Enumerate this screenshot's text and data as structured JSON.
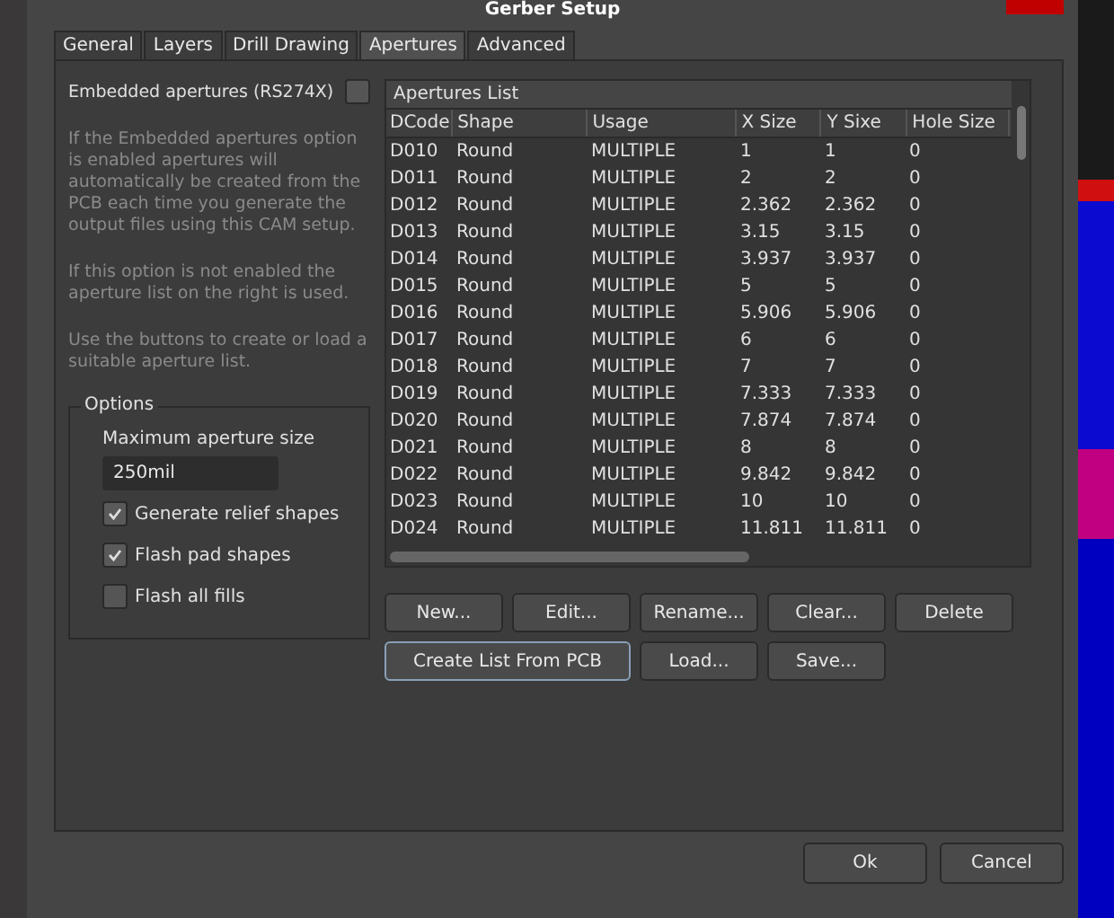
{
  "window": {
    "title": "Gerber Setup"
  },
  "tabs": [
    {
      "label": "General",
      "selected": false
    },
    {
      "label": "Layers",
      "selected": false
    },
    {
      "label": "Drill Drawing",
      "selected": false
    },
    {
      "label": "Apertures",
      "selected": true
    },
    {
      "label": "Advanced",
      "selected": false
    }
  ],
  "embedded": {
    "label": "Embedded apertures (RS274X)",
    "checked": false
  },
  "help_texts": [
    "If the Embedded apertures option is enabled apertures will automatically be created from the PCB each time you generate the output files using this CAM setup.",
    "If this option is not enabled the aperture list on the right is used.",
    "Use the buttons to create or load a suitable aperture list."
  ],
  "options": {
    "title": "Options",
    "max_size_label": "Maximum aperture size",
    "max_size_value": "250mil",
    "checkboxes": [
      {
        "label": "Generate relief shapes",
        "checked": true
      },
      {
        "label": "Flash pad shapes",
        "checked": true
      },
      {
        "label": "Flash all fills",
        "checked": false
      }
    ]
  },
  "apertures_list": {
    "title": "Apertures List",
    "columns": [
      "DCode",
      "Shape",
      "Usage",
      "X Size",
      "Y Sixe",
      "Hole Size"
    ],
    "rows": [
      [
        "D010",
        "Round",
        "MULTIPLE",
        "1",
        "1",
        "0"
      ],
      [
        "D011",
        "Round",
        "MULTIPLE",
        "2",
        "2",
        "0"
      ],
      [
        "D012",
        "Round",
        "MULTIPLE",
        "2.362",
        "2.362",
        "0"
      ],
      [
        "D013",
        "Round",
        "MULTIPLE",
        "3.15",
        "3.15",
        "0"
      ],
      [
        "D014",
        "Round",
        "MULTIPLE",
        "3.937",
        "3.937",
        "0"
      ],
      [
        "D015",
        "Round",
        "MULTIPLE",
        "5",
        "5",
        "0"
      ],
      [
        "D016",
        "Round",
        "MULTIPLE",
        "5.906",
        "5.906",
        "0"
      ],
      [
        "D017",
        "Round",
        "MULTIPLE",
        "6",
        "6",
        "0"
      ],
      [
        "D018",
        "Round",
        "MULTIPLE",
        "7",
        "7",
        "0"
      ],
      [
        "D019",
        "Round",
        "MULTIPLE",
        "7.333",
        "7.333",
        "0"
      ],
      [
        "D020",
        "Round",
        "MULTIPLE",
        "7.874",
        "7.874",
        "0"
      ],
      [
        "D021",
        "Round",
        "MULTIPLE",
        "8",
        "8",
        "0"
      ],
      [
        "D022",
        "Round",
        "MULTIPLE",
        "9.842",
        "9.842",
        "0"
      ],
      [
        "D023",
        "Round",
        "MULTIPLE",
        "10",
        "10",
        "0"
      ],
      [
        "D024",
        "Round",
        "MULTIPLE",
        "11.811",
        "11.811",
        "0"
      ]
    ]
  },
  "list_buttons": [
    [
      "New...",
      "Edit...",
      "Rename...",
      "Clear...",
      "Delete"
    ],
    [
      "Create List From PCB",
      "Load...",
      "Save..."
    ]
  ],
  "dialog_buttons": [
    "Ok",
    "Cancel"
  ]
}
